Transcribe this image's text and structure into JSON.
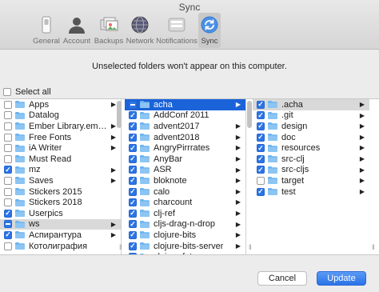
{
  "window": {
    "title": "Sync"
  },
  "toolbar": {
    "items": [
      {
        "label": "General",
        "icon": "switch-icon"
      },
      {
        "label": "Account",
        "icon": "person-icon"
      },
      {
        "label": "Backups",
        "icon": "backups-icon"
      },
      {
        "label": "Network",
        "icon": "globe-icon"
      },
      {
        "label": "Notifications",
        "icon": "bell-icon"
      },
      {
        "label": "Sync",
        "icon": "sync-icon",
        "selected": true
      }
    ]
  },
  "notice": "Unselected folders won't appear on this computer.",
  "select_all": {
    "label": "Select all",
    "checked": false
  },
  "columns": [
    [
      {
        "label": "Apps",
        "state": "unchecked",
        "arrow": true
      },
      {
        "label": "Datalog",
        "state": "unchecked",
        "arrow": false
      },
      {
        "label": "Ember Library.embe…",
        "state": "unchecked",
        "arrow": true
      },
      {
        "label": "Free Fonts",
        "state": "unchecked",
        "arrow": true
      },
      {
        "label": "iA Writer",
        "state": "unchecked",
        "arrow": true
      },
      {
        "label": "Must Read",
        "state": "unchecked",
        "arrow": false
      },
      {
        "label": "mz",
        "state": "checked",
        "arrow": true
      },
      {
        "label": "Saves",
        "state": "unchecked",
        "arrow": true
      },
      {
        "label": "Stickers 2015",
        "state": "unchecked",
        "arrow": false
      },
      {
        "label": "Stickers 2018",
        "state": "unchecked",
        "arrow": false
      },
      {
        "label": "Userpics",
        "state": "checked",
        "arrow": false
      },
      {
        "label": "ws",
        "state": "mixed",
        "arrow": true,
        "highlight": "gray"
      },
      {
        "label": "Аспирантура",
        "state": "checked",
        "arrow": true
      },
      {
        "label": "Котолиграфия",
        "state": "unchecked",
        "arrow": false
      }
    ],
    [
      {
        "label": "acha",
        "state": "mixed",
        "arrow": true,
        "highlight": "blue"
      },
      {
        "label": "AddConf 2011",
        "state": "checked",
        "arrow": false
      },
      {
        "label": "advent2017",
        "state": "checked",
        "arrow": true
      },
      {
        "label": "advent2018",
        "state": "checked",
        "arrow": true
      },
      {
        "label": "AngryPirrrates",
        "state": "checked",
        "arrow": true
      },
      {
        "label": "AnyBar",
        "state": "checked",
        "arrow": true
      },
      {
        "label": "ASR",
        "state": "checked",
        "arrow": true
      },
      {
        "label": "bloknote",
        "state": "checked",
        "arrow": true
      },
      {
        "label": "calo",
        "state": "checked",
        "arrow": true
      },
      {
        "label": "charcount",
        "state": "checked",
        "arrow": true
      },
      {
        "label": "clj-ref",
        "state": "checked",
        "arrow": true
      },
      {
        "label": "cljs-drag-n-drop",
        "state": "checked",
        "arrow": true
      },
      {
        "label": "clojure-bits",
        "state": "checked",
        "arrow": true
      },
      {
        "label": "clojure-bits-server",
        "state": "checked",
        "arrow": true
      },
      {
        "label": "clojure-future-spec",
        "state": "checked",
        "arrow": true
      }
    ],
    [
      {
        "label": ".acha",
        "state": "checked",
        "arrow": true,
        "highlight": "gray"
      },
      {
        "label": ".git",
        "state": "checked",
        "arrow": true
      },
      {
        "label": "design",
        "state": "checked",
        "arrow": true
      },
      {
        "label": "doc",
        "state": "checked",
        "arrow": true
      },
      {
        "label": "resources",
        "state": "checked",
        "arrow": true
      },
      {
        "label": "src-clj",
        "state": "checked",
        "arrow": true
      },
      {
        "label": "src-cljs",
        "state": "checked",
        "arrow": true
      },
      {
        "label": "target",
        "state": "unchecked",
        "arrow": true
      },
      {
        "label": "test",
        "state": "checked",
        "arrow": true
      }
    ]
  ],
  "buttons": {
    "cancel": "Cancel",
    "update": "Update"
  },
  "colors": {
    "accent": "#2d74e6",
    "selection": "#1b63d9",
    "folder": "#6db3ef"
  }
}
